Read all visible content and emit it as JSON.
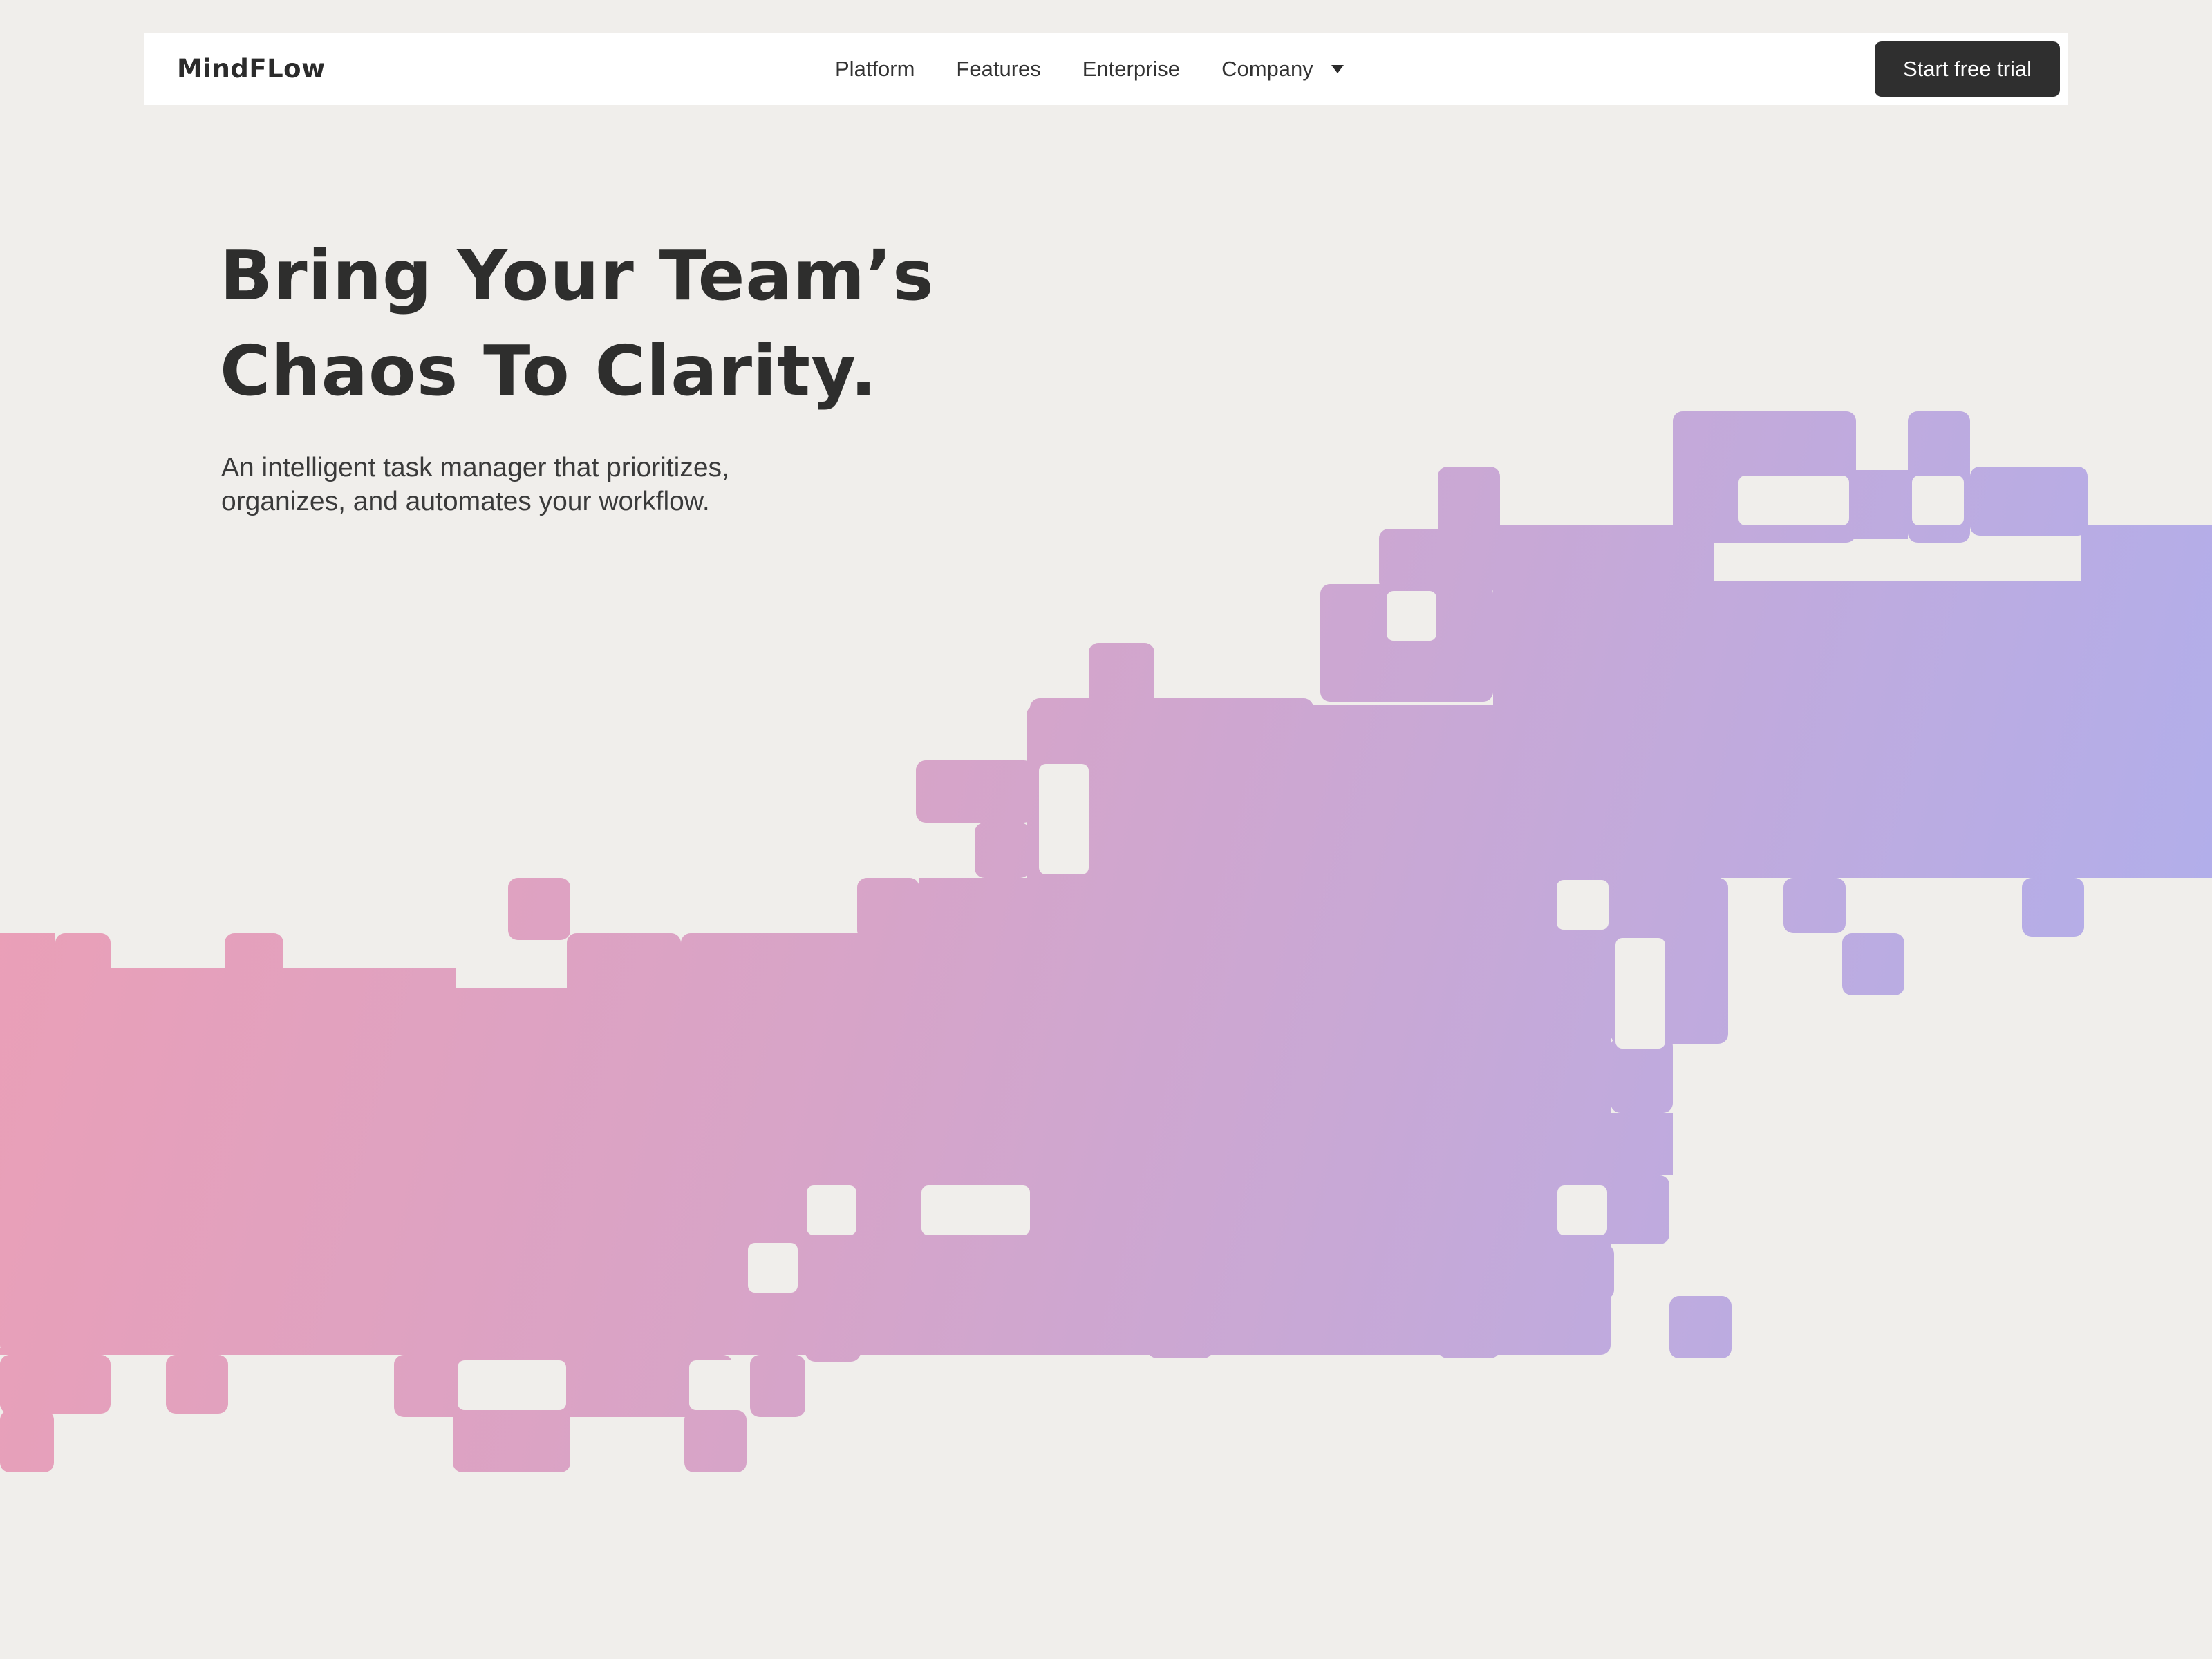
{
  "brand": {
    "name": "MindFLow"
  },
  "nav": {
    "items": [
      {
        "label": "Platform"
      },
      {
        "label": "Features"
      },
      {
        "label": "Enterprise"
      },
      {
        "label": "Company"
      }
    ],
    "cta_label": "Start free trial"
  },
  "hero": {
    "title_line1": "Bring Your Team’s",
    "title_line2": "Chaos To Clarity.",
    "subtitle_line1": "An intelligent task manager that prioritizes,",
    "subtitle_line2": "organizes, and automates your workflow."
  },
  "colors": {
    "background": "#f0eeeb",
    "wave_gradient_start": "#ea9fb7",
    "wave_gradient_mid": "#d9a3c6",
    "wave_gradient_end": "#b2aeea",
    "cta_background": "#2f2f2f"
  },
  "icons": {
    "company_dropdown": "chevron-down-icon"
  }
}
